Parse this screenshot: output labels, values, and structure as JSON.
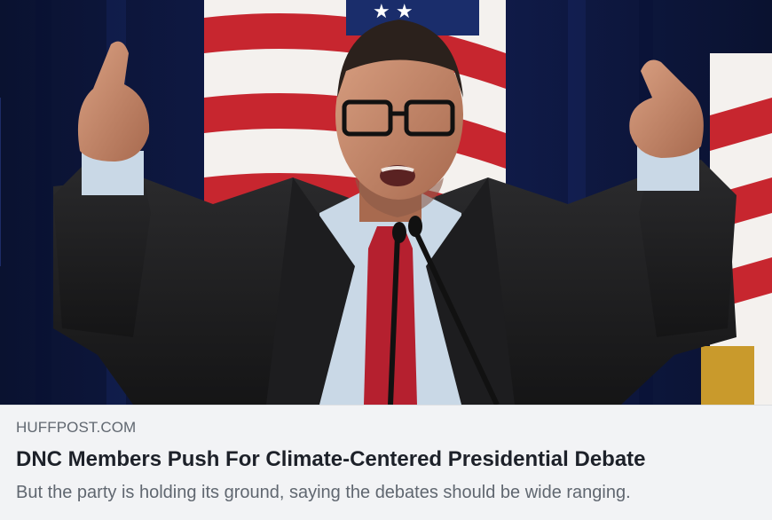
{
  "link_preview": {
    "domain": "HUFFPOST.COM",
    "headline": "DNC Members Push For Climate-Centered Presidential Debate",
    "description": "But the party is holding its ground, saying the debates should be wide ranging."
  },
  "colors": {
    "caption_background": "#f2f3f5",
    "headline_text": "#1d2129",
    "secondary_text": "#606770",
    "divider": "#dddfe2"
  }
}
